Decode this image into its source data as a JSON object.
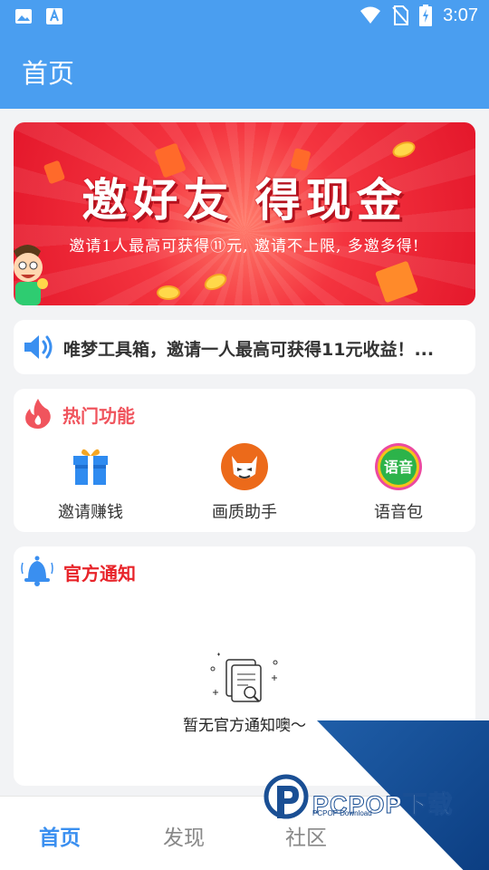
{
  "status_bar": {
    "time": "3:07",
    "icons": [
      "image-icon",
      "text-app-icon",
      "wifi-icon",
      "no-sim-icon",
      "battery-charging-icon"
    ]
  },
  "app_bar": {
    "title": "首页"
  },
  "banner": {
    "title": "邀好友 得现金",
    "subtitle": "邀请1人最高可获得⑪元, 邀请不上限, 多邀多得!"
  },
  "announcement": {
    "text": "唯梦工具箱，邀请一人最高可获得11元收益！..."
  },
  "hot_features": {
    "title": "热门功能",
    "items": [
      {
        "label": "邀请赚钱",
        "icon": "gift-icon"
      },
      {
        "label": "画质助手",
        "icon": "devil-face-icon"
      },
      {
        "label": "语音包",
        "icon": "voice-pack-icon",
        "icon_text": "语音"
      }
    ]
  },
  "official_notices": {
    "title": "官方通知",
    "empty_text": "暂无官方通知噢～"
  },
  "bottom_nav": {
    "items": [
      {
        "label": "首页",
        "active": true
      },
      {
        "label": "发现",
        "active": false
      },
      {
        "label": "社区",
        "active": false
      }
    ]
  },
  "watermark": {
    "text": "PCPOP下载",
    "sub": "PCPOP Download"
  },
  "colors": {
    "primary": "#4a9ef0",
    "hot_red": "#f0545d",
    "notice_red": "#e8242a",
    "nav_active": "#3a8ff0"
  }
}
